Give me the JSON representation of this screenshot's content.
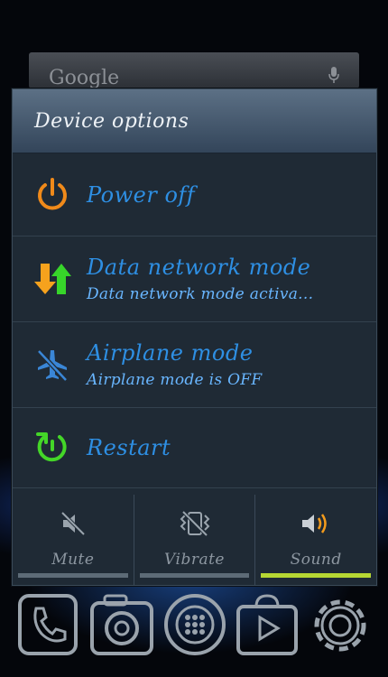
{
  "search": {
    "label": "Google",
    "mic_icon": "microphone-icon"
  },
  "dialog": {
    "title": "Device options",
    "options": [
      {
        "icon": "power-icon",
        "title": "Power off",
        "subtitle": ""
      },
      {
        "icon": "data-arrows-icon",
        "title": "Data network mode",
        "subtitle": "Data network mode activa..."
      },
      {
        "icon": "airplane-off-icon",
        "title": "Airplane mode",
        "subtitle": "Airplane mode is OFF"
      },
      {
        "icon": "restart-icon",
        "title": "Restart",
        "subtitle": ""
      }
    ],
    "sound_modes": [
      {
        "label": "Mute",
        "icon": "mute-icon",
        "active": false
      },
      {
        "label": "Vibrate",
        "icon": "vibrate-icon",
        "active": false
      },
      {
        "label": "Sound",
        "icon": "speaker-icon",
        "active": true
      }
    ]
  },
  "dock": [
    "phone-icon",
    "camera-icon",
    "apps-icon",
    "play-store-icon",
    "settings-icon"
  ],
  "colors": {
    "accent_blue": "#2e8fe3",
    "active_bar": "#b6d733",
    "power_orange": "#f08a1a",
    "restart_green": "#44d628"
  }
}
